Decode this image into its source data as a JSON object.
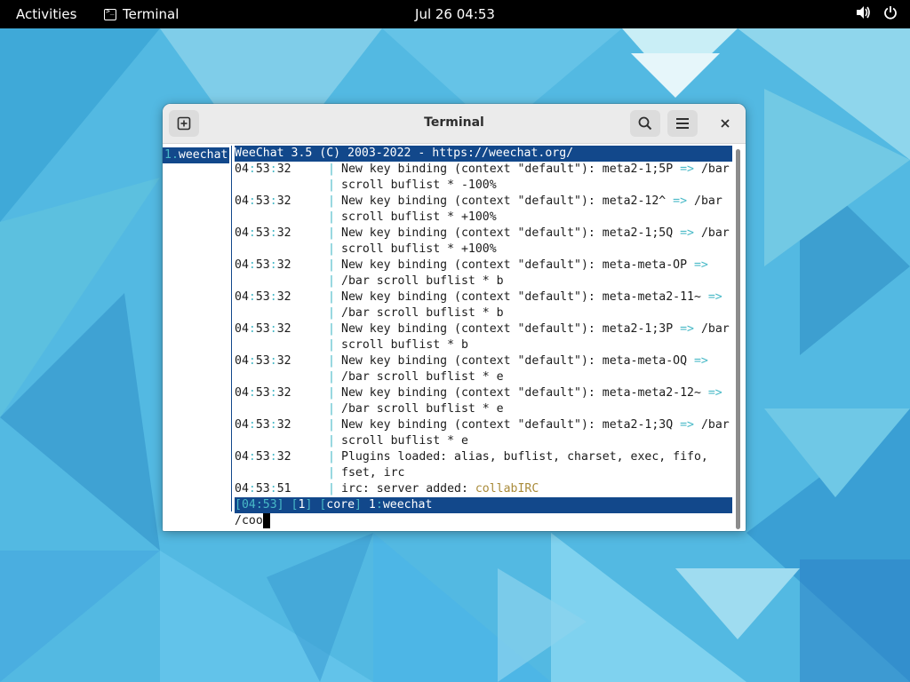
{
  "topbar": {
    "activities": "Activities",
    "app_name": "Terminal",
    "clock": "Jul 26  04:53"
  },
  "window": {
    "title": "Terminal"
  },
  "buffers": {
    "selected_num": "1.",
    "selected_name": "weechat"
  },
  "weechat": {
    "title": "WeeChat 3.5 (C) 2003-2022 - https://weechat.org/",
    "lines": [
      {
        "ts": "04:53:32",
        "msg": "New key binding (context \"default\"): meta2-1;5P => /bar"
      },
      {
        "ts": "",
        "msg": "scroll buflist * -100%"
      },
      {
        "ts": "04:53:32",
        "msg": "New key binding (context \"default\"): meta2-12^ => /bar"
      },
      {
        "ts": "",
        "msg": "scroll buflist * +100%"
      },
      {
        "ts": "04:53:32",
        "msg": "New key binding (context \"default\"): meta2-1;5Q => /bar"
      },
      {
        "ts": "",
        "msg": "scroll buflist * +100%"
      },
      {
        "ts": "04:53:32",
        "msg": "New key binding (context \"default\"): meta-meta-OP =>"
      },
      {
        "ts": "",
        "msg": "/bar scroll buflist * b"
      },
      {
        "ts": "04:53:32",
        "msg": "New key binding (context \"default\"): meta-meta2-11~ =>"
      },
      {
        "ts": "",
        "msg": "/bar scroll buflist * b"
      },
      {
        "ts": "04:53:32",
        "msg": "New key binding (context \"default\"): meta2-1;3P => /bar"
      },
      {
        "ts": "",
        "msg": "scroll buflist * b"
      },
      {
        "ts": "04:53:32",
        "msg": "New key binding (context \"default\"): meta-meta-OQ =>"
      },
      {
        "ts": "",
        "msg": "/bar scroll buflist * e"
      },
      {
        "ts": "04:53:32",
        "msg": "New key binding (context \"default\"): meta-meta2-12~ =>"
      },
      {
        "ts": "",
        "msg": "/bar scroll buflist * e"
      },
      {
        "ts": "04:53:32",
        "msg": "New key binding (context \"default\"): meta2-1;3Q => /bar"
      },
      {
        "ts": "",
        "msg": "scroll buflist * e"
      },
      {
        "ts": "04:53:32",
        "msg": "Plugins loaded: alias, buflist, charset, exec, fifo,"
      },
      {
        "ts": "",
        "msg": "fset, irc"
      },
      {
        "ts": "04:53:51",
        "msg": "irc: server added: collabIRC"
      }
    ],
    "status": {
      "time": "04:53",
      "num": "1",
      "plugin": "core",
      "buffer_num": "1",
      "buffer_sep": ":",
      "buffer_name": "weechat"
    },
    "input": "/coo"
  },
  "colors": {
    "bar_bg": "#12488b",
    "accent_cyan": "#48b9c7",
    "server_name": "#a98b3a"
  },
  "icons": [
    "terminal-app-icon",
    "volume-icon",
    "power-icon",
    "new-tab-icon",
    "search-icon",
    "hamburger-menu-icon",
    "close-icon"
  ]
}
